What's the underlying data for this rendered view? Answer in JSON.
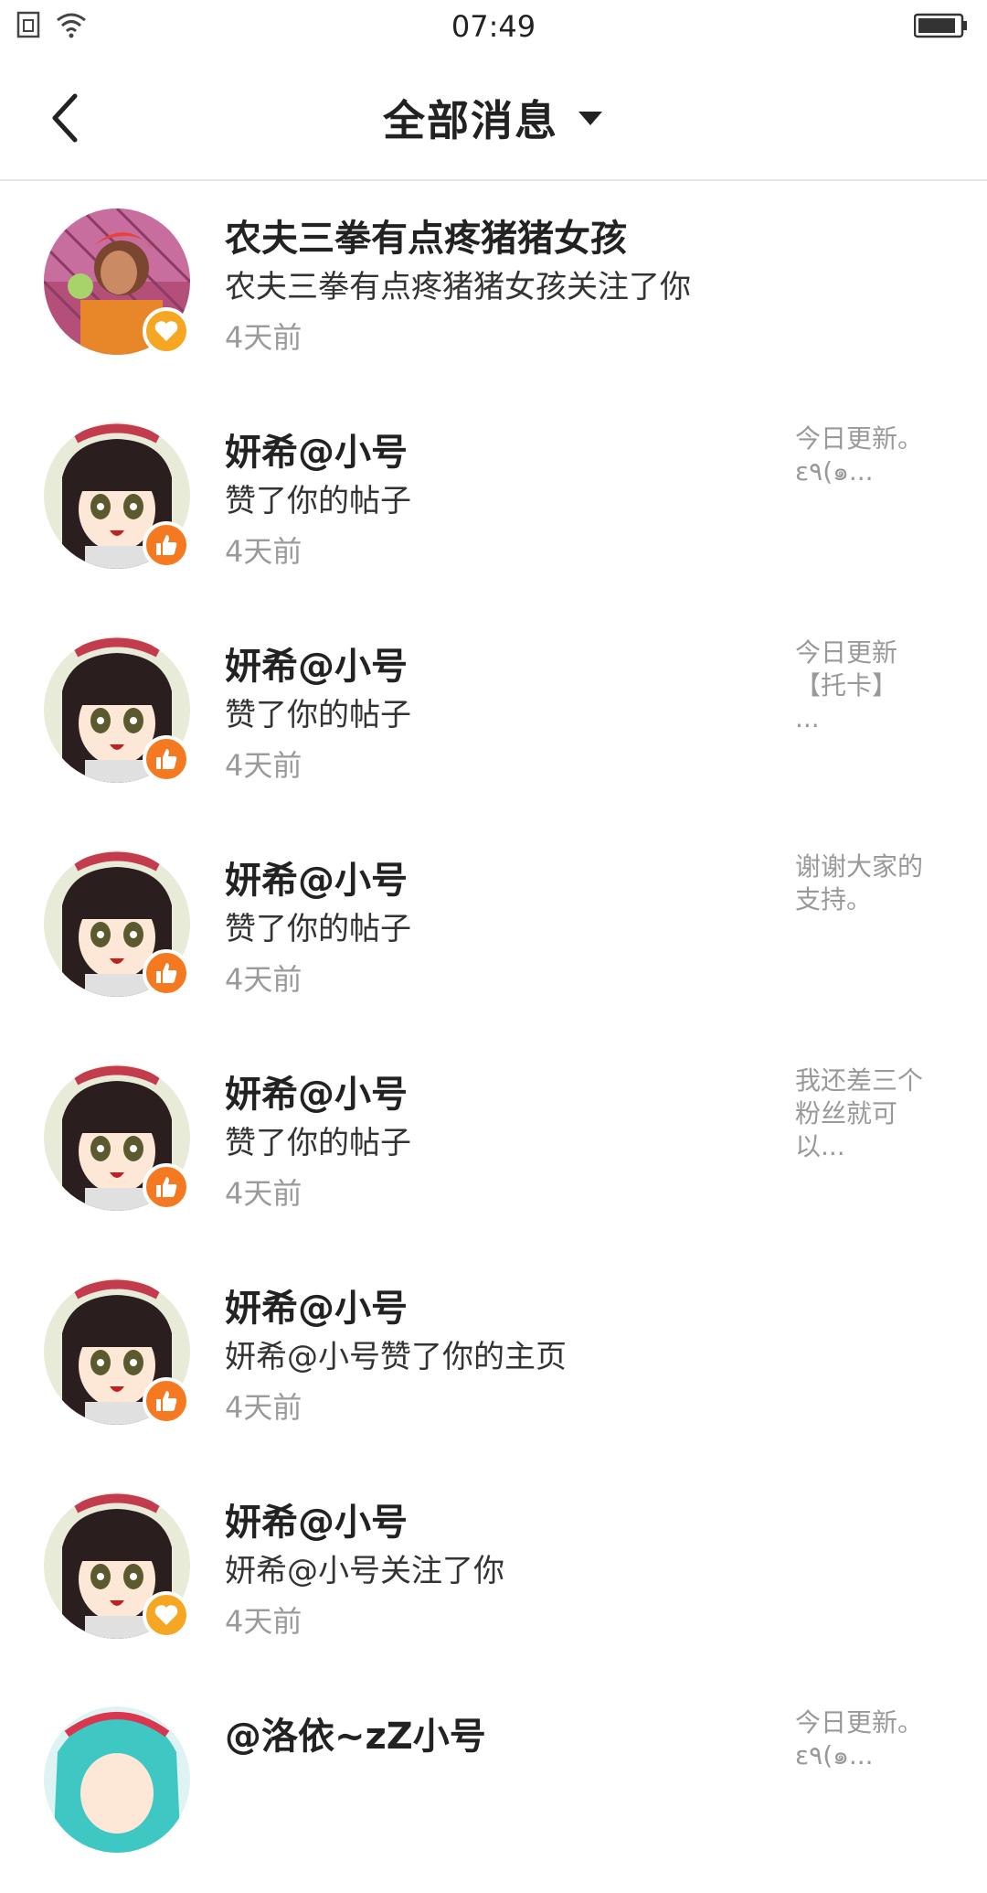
{
  "status_bar": {
    "time": "07:49"
  },
  "header": {
    "title": "全部消息"
  },
  "colors": {
    "like_badge": "#f47920",
    "follow_badge": "#f5a623",
    "divider": "#e6e6e6",
    "time_text": "#9a9a9a",
    "preview_text": "#999999"
  },
  "messages": [
    {
      "name": "农夫三拳有点疼猪猪女孩",
      "desc": "农夫三拳有点疼猪猪女孩关注了你",
      "time": "4天前",
      "preview": "",
      "badge": "heart-icon"
    },
    {
      "name": "妍希@小号",
      "desc": "赞了你的帖子",
      "time": "4天前",
      "preview": "今日更新。\nε٩(๑...",
      "badge": "thumbs-up-icon"
    },
    {
      "name": "妍希@小号",
      "desc": "赞了你的帖子",
      "time": "4天前",
      "preview": "今日更新\n【托卡】\n...",
      "badge": "thumbs-up-icon"
    },
    {
      "name": "妍希@小号",
      "desc": "赞了你的帖子",
      "time": "4天前",
      "preview": "谢谢大家的\n支持。",
      "badge": "thumbs-up-icon"
    },
    {
      "name": "妍希@小号",
      "desc": "赞了你的帖子",
      "time": "4天前",
      "preview": "我还差三个\n粉丝就可\n以...",
      "badge": "thumbs-up-icon"
    },
    {
      "name": "妍希@小号",
      "desc": "妍希@小号赞了你的主页",
      "time": "4天前",
      "preview": "",
      "badge": "thumbs-up-icon"
    },
    {
      "name": "妍希@小号",
      "desc": "妍希@小号关注了你",
      "time": "4天前",
      "preview": "",
      "badge": "heart-icon"
    },
    {
      "name": "@洛依~zZ小号",
      "desc": "",
      "time": "",
      "preview": "今日更新。\nε٩(๑...",
      "badge": ""
    }
  ]
}
